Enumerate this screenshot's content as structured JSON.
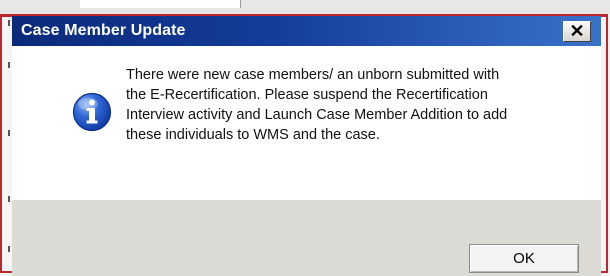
{
  "dialog": {
    "title": "Case Member Update",
    "close_label": "✕",
    "message_lines": [
      "There were new case members/ an unborn submitted with",
      "the E-Recertification. Please suspend the Recertification",
      "Interview activity and Launch Case Member Addition to add",
      "these individuals to WMS and the case."
    ],
    "ok_label": "OK"
  },
  "colors": {
    "frame_border": "#c0262d",
    "titlebar_start": "#0b2a7a",
    "titlebar_end": "#3a71c9",
    "info_icon": "#1d56c7"
  },
  "icons": {
    "info": "info-icon",
    "close": "close-icon"
  }
}
